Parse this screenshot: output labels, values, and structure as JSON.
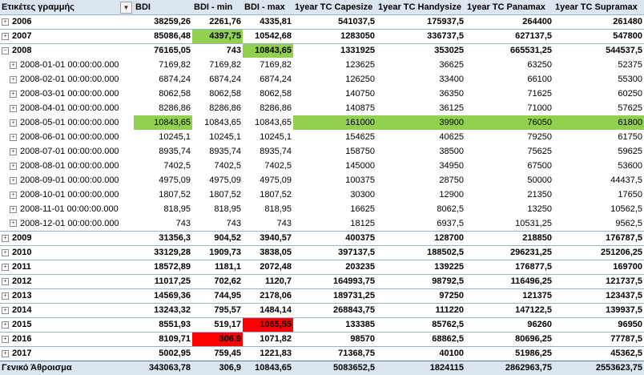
{
  "header": {
    "row_labels": "Ετικέτες γραμμής",
    "columns": [
      "BDI",
      "BDI - min",
      "BDI - max",
      "1year TC Capesize",
      "1year TC Handysize",
      "1year TC Panamax",
      "1year TC Supramax"
    ]
  },
  "colors": {
    "highlight_green": "#92d050",
    "highlight_red": "#ff0000",
    "header_bg": "#dce6f1"
  },
  "rows": [
    {
      "type": "year",
      "toggle": "+",
      "label": "2006",
      "values": [
        "38259,26",
        "2261,76",
        "4335,81",
        "541037,5",
        "175937,5",
        "264400",
        "261480"
      ],
      "hl": [
        "",
        "",
        "",
        "",
        "",
        "",
        ""
      ]
    },
    {
      "type": "year",
      "toggle": "+",
      "label": "2007",
      "values": [
        "85086,48",
        "4397,75",
        "10542,68",
        "1283050",
        "336737,5",
        "627137,5",
        "547800"
      ],
      "hl": [
        "",
        "green",
        "",
        "",
        "",
        "",
        ""
      ]
    },
    {
      "type": "year",
      "toggle": "−",
      "label": "2008",
      "values": [
        "76165,05",
        "743",
        "10843,65",
        "1331925",
        "353025",
        "665531,25",
        "544537,5"
      ],
      "hl": [
        "",
        "",
        "green",
        "",
        "",
        "",
        ""
      ]
    },
    {
      "type": "month",
      "toggle": "+",
      "label": "2008-01-01 00:00:00.000",
      "values": [
        "7169,82",
        "7169,82",
        "7169,82",
        "123625",
        "36625",
        "63250",
        "52375"
      ],
      "hl": [
        "",
        "",
        "",
        "",
        "",
        "",
        ""
      ]
    },
    {
      "type": "month",
      "toggle": "+",
      "label": "2008-02-01 00:00:00.000",
      "values": [
        "6874,24",
        "6874,24",
        "6874,24",
        "126250",
        "33400",
        "66100",
        "55300"
      ],
      "hl": [
        "",
        "",
        "",
        "",
        "",
        "",
        ""
      ]
    },
    {
      "type": "month",
      "toggle": "+",
      "label": "2008-03-01 00:00:00.000",
      "values": [
        "8062,58",
        "8062,58",
        "8062,58",
        "140750",
        "36350",
        "71625",
        "60250"
      ],
      "hl": [
        "",
        "",
        "",
        "",
        "",
        "",
        ""
      ]
    },
    {
      "type": "month",
      "toggle": "+",
      "label": "2008-04-01 00:00:00.000",
      "values": [
        "8286,86",
        "8286,86",
        "8286,86",
        "140875",
        "36125",
        "71000",
        "57625"
      ],
      "hl": [
        "",
        "",
        "",
        "",
        "",
        "",
        ""
      ]
    },
    {
      "type": "month",
      "toggle": "+",
      "label": "2008-05-01 00:00:00.000",
      "values": [
        "10843,65",
        "10843,65",
        "10843,65",
        "161000",
        "39900",
        "76050",
        "61800"
      ],
      "hl": [
        "green",
        "",
        "",
        "green",
        "green",
        "green",
        "green"
      ]
    },
    {
      "type": "month",
      "toggle": "+",
      "label": "2008-06-01 00:00:00.000",
      "values": [
        "10245,1",
        "10245,1",
        "10245,1",
        "154625",
        "40625",
        "79250",
        "61750"
      ],
      "hl": [
        "",
        "",
        "",
        "",
        "",
        "",
        ""
      ]
    },
    {
      "type": "month",
      "toggle": "+",
      "label": "2008-07-01 00:00:00.000",
      "values": [
        "8935,74",
        "8935,74",
        "8935,74",
        "158750",
        "38500",
        "75625",
        "59625"
      ],
      "hl": [
        "",
        "",
        "",
        "",
        "",
        "",
        ""
      ]
    },
    {
      "type": "month",
      "toggle": "+",
      "label": "2008-08-01 00:00:00.000",
      "values": [
        "7402,5",
        "7402,5",
        "7402,5",
        "145000",
        "34950",
        "67500",
        "53600"
      ],
      "hl": [
        "",
        "",
        "",
        "",
        "",
        "",
        ""
      ]
    },
    {
      "type": "month",
      "toggle": "+",
      "label": "2008-09-01 00:00:00.000",
      "values": [
        "4975,09",
        "4975,09",
        "4975,09",
        "100375",
        "28750",
        "50000",
        "44437,5"
      ],
      "hl": [
        "",
        "",
        "",
        "",
        "",
        "",
        ""
      ]
    },
    {
      "type": "month",
      "toggle": "+",
      "label": "2008-10-01 00:00:00.000",
      "values": [
        "1807,52",
        "1807,52",
        "1807,52",
        "30300",
        "12900",
        "21350",
        "17650"
      ],
      "hl": [
        "",
        "",
        "",
        "",
        "",
        "",
        ""
      ]
    },
    {
      "type": "month",
      "toggle": "+",
      "label": "2008-11-01 00:00:00.000",
      "values": [
        "818,95",
        "818,95",
        "818,95",
        "16625",
        "8062,5",
        "13250",
        "10562,5"
      ],
      "hl": [
        "",
        "",
        "",
        "",
        "",
        "",
        ""
      ]
    },
    {
      "type": "month",
      "toggle": "+",
      "label": "2008-12-01 00:00:00.000",
      "values": [
        "743",
        "743",
        "743",
        "18125",
        "6937,5",
        "10531,25",
        "9562,5"
      ],
      "hl": [
        "",
        "",
        "",
        "",
        "",
        "",
        ""
      ]
    },
    {
      "type": "year",
      "toggle": "+",
      "label": "2009",
      "values": [
        "31356,3",
        "904,52",
        "3940,57",
        "400375",
        "128700",
        "218850",
        "176787,5"
      ],
      "hl": [
        "",
        "",
        "",
        "",
        "",
        "",
        ""
      ]
    },
    {
      "type": "year",
      "toggle": "+",
      "label": "2010",
      "values": [
        "33129,28",
        "1909,73",
        "3838,05",
        "397137,5",
        "188502,5",
        "296231,25",
        "251206,25"
      ],
      "hl": [
        "",
        "",
        "",
        "",
        "",
        "",
        ""
      ]
    },
    {
      "type": "year",
      "toggle": "+",
      "label": "2011",
      "values": [
        "18572,89",
        "1181,1",
        "2072,48",
        "203235",
        "139225",
        "176877,5",
        "169700"
      ],
      "hl": [
        "",
        "",
        "",
        "",
        "",
        "",
        ""
      ]
    },
    {
      "type": "year",
      "toggle": "+",
      "label": "2012",
      "values": [
        "11017,25",
        "702,62",
        "1120,7",
        "164993,75",
        "98792,5",
        "116496,25",
        "121737,5"
      ],
      "hl": [
        "",
        "",
        "",
        "",
        "",
        "",
        ""
      ]
    },
    {
      "type": "year",
      "toggle": "+",
      "label": "2013",
      "values": [
        "14569,36",
        "744,95",
        "2178,06",
        "189731,25",
        "97250",
        "121375",
        "123437,5"
      ],
      "hl": [
        "",
        "",
        "",
        "",
        "",
        "",
        ""
      ]
    },
    {
      "type": "year",
      "toggle": "+",
      "label": "2014",
      "values": [
        "13243,32",
        "795,57",
        "1484,14",
        "268843,75",
        "111220",
        "147122,5",
        "139937,5"
      ],
      "hl": [
        "",
        "",
        "",
        "",
        "",
        "",
        ""
      ]
    },
    {
      "type": "year",
      "toggle": "+",
      "label": "2015",
      "values": [
        "8551,93",
        "519,17",
        "1065,55",
        "133385",
        "85762,5",
        "96260",
        "96950"
      ],
      "hl": [
        "",
        "",
        "red",
        "",
        "",
        "",
        ""
      ]
    },
    {
      "type": "year",
      "toggle": "+",
      "label": "2016",
      "values": [
        "8109,71",
        "306,9",
        "1071,82",
        "98570",
        "68862,5",
        "80696,25",
        "77787,5"
      ],
      "hl": [
        "",
        "red",
        "",
        "",
        "",
        "",
        ""
      ]
    },
    {
      "type": "year",
      "toggle": "+",
      "label": "2017",
      "values": [
        "5002,95",
        "759,45",
        "1221,83",
        "71368,75",
        "40100",
        "51986,25",
        "45362,5"
      ],
      "hl": [
        "",
        "",
        "",
        "",
        "",
        "",
        ""
      ]
    }
  ],
  "total": {
    "label": "Γενικό Άθροισμα",
    "values": [
      "343063,78",
      "306,9",
      "10843,65",
      "5083652,5",
      "1824115",
      "2862963,75",
      "2553623,75"
    ]
  }
}
